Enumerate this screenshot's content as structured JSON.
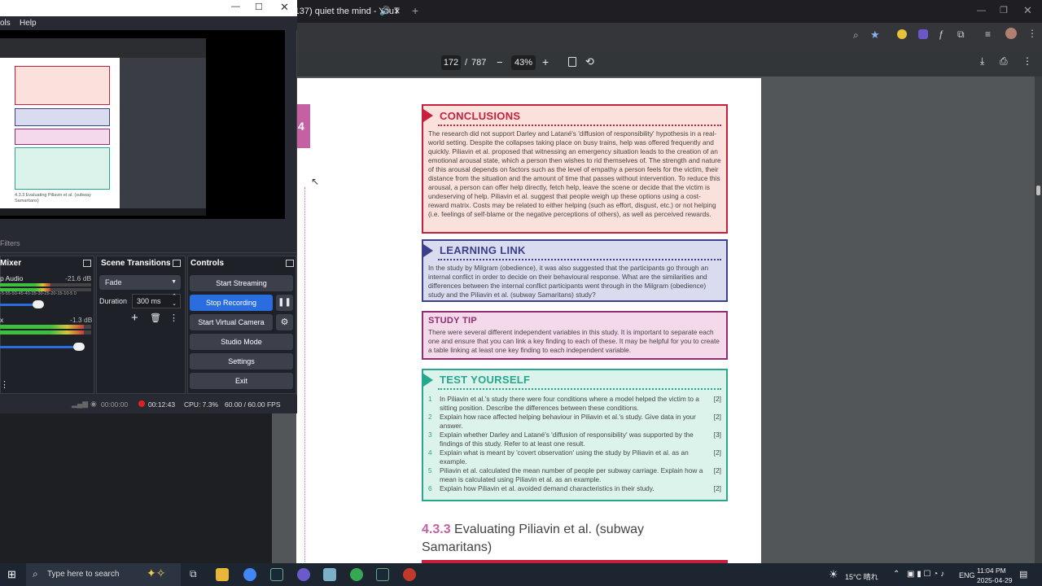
{
  "browser": {
    "tab_title": "(137) quiet the mind - YouT",
    "pdf": {
      "page_current": "172",
      "page_sep": "/",
      "page_total": "787",
      "zoom": "43%"
    }
  },
  "pdf_page": {
    "side_tab": "4",
    "conclusions": {
      "title": "CONCLUSIONS",
      "body": "The research did not support Darley and Latané's 'diffusion of responsibility' hypothesis in a real-world setting. Despite the collapses taking place on busy trains, help was offered frequently and quickly. Piliavin et al. proposed that witnessing an emergency situation leads to the creation of an emotional arousal state, which a person then wishes to rid themselves of. The strength and nature of this arousal depends on factors such as the level of empathy a person feels for the victim, their distance from the situation and the amount of time that passes without intervention. To reduce this arousal, a person can offer help directly, fetch help, leave the scene or decide that the victim is undeserving of help. Piliavin et al. suggest that people weigh up these options using a cost-reward matrix. Costs may be related to either helping (such as effort, disgust, etc.) or not helping (i.e. feelings of self-blame or the negative perceptions of others), as well as perceived rewards."
    },
    "learning_link": {
      "title": "LEARNING LINK",
      "body": "In the study by Milgram (obedience), it was also suggested that the participants go through an internal conflict in order to decide on their behavioural response. What are the similarities and differences between the internal conflict participants went through in the Milgram (obedience) study and the Piliavin et al. (subway Samaritans) study?"
    },
    "study_tip": {
      "title": "STUDY TIP",
      "body": "There were several different independent variables in this study. It is important to separate each one and ensure that you can link a key finding to each of these. It may be helpful for you to create a table linking at least one key finding to each independent variable."
    },
    "test_yourself": {
      "title": "TEST YOURSELF",
      "questions": [
        {
          "n": "1",
          "text": "In Piliavin et al.'s study there were four conditions where a model helped the victim to a sitting position. Describe the differences between these conditions.",
          "marks": "[2]"
        },
        {
          "n": "2",
          "text": "Explain how race affected helping behaviour in Piliavin et al.'s study. Give data in your answer.",
          "marks": "[2]"
        },
        {
          "n": "3",
          "text": "Explain whether Darley and Latané's 'diffusion of responsibility' was supported by the findings of this study. Refer to at least one result.",
          "marks": "[3]"
        },
        {
          "n": "4",
          "text": "Explain what is meant by 'covert observation' using the study by Piliavin et al. as an example.",
          "marks": "[2]"
        },
        {
          "n": "5",
          "text": "Piliavin et al. calculated the mean number of people per subway carriage. Explain how a mean is calculated using Piliavin et al. as an example.",
          "marks": "[2]"
        },
        {
          "n": "6",
          "text": "Explain how Piliavin et al. avoided demand characteristics in their study.",
          "marks": "[2]"
        }
      ]
    },
    "section_number": "4.3.3",
    "section_title": "Evaluating Piliavin et al. (subway Samaritans)"
  },
  "obs": {
    "menu": [
      "ols",
      "Help"
    ],
    "filters_label": "Filters",
    "mixer": {
      "title": "Mixer",
      "ticks": "-5-55-50-45-40-35-30-25-20-15-10-5 0",
      "tracks": [
        {
          "name": "p Audio",
          "db": "-21.6 dB",
          "level": 0.55
        },
        {
          "name": "x",
          "db": "-1.3 dB",
          "level": 0.92
        }
      ]
    },
    "transitions": {
      "title": "Scene Transitions",
      "selected": "Fade",
      "duration_label": "Duration",
      "duration_value": "300 ms"
    },
    "controls": {
      "title": "Controls",
      "start_streaming": "Start Streaming",
      "stop_recording": "Stop Recording",
      "start_virtual_camera": "Start Virtual Camera",
      "studio_mode": "Studio Mode",
      "settings": "Settings",
      "exit": "Exit"
    },
    "status": {
      "stream_time": "00:00:00",
      "rec_time": "00:12:43",
      "cpu": "CPU: 7.3%",
      "fps": "60.00 / 60.00 FPS"
    },
    "preview_caption": "4.3.3 Evaluating Piliavin et al. (subway Samaritans)"
  },
  "taskbar": {
    "search_placeholder": "Type here to search",
    "weather": "15°C 晴れ",
    "lang": "ENG",
    "time": "11:04 PM",
    "date": "2025-04-29"
  },
  "colors": {
    "conclusions": "#c8203c",
    "learning_link": "#3b3f8c",
    "study_tip": "#8e2f73",
    "test_yourself": "#26a88e",
    "obs_blue": "#2a6dde"
  }
}
